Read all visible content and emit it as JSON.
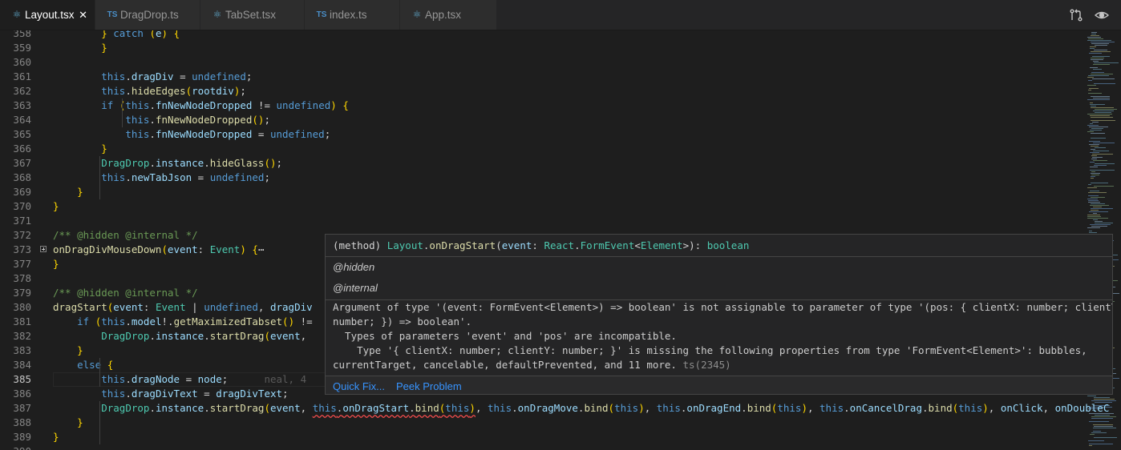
{
  "tabs": [
    {
      "name": "tab-layout",
      "label": "Layout.tsx",
      "icon": "react-icon",
      "active": true,
      "close": "✕"
    },
    {
      "name": "tab-dragdrop",
      "label": "DragDrop.ts",
      "icon": "ts-icon",
      "active": false
    },
    {
      "name": "tab-tabset",
      "label": "TabSet.tsx",
      "icon": "react-icon",
      "active": false
    },
    {
      "name": "tab-index",
      "label": "index.ts",
      "icon": "ts-icon",
      "active": false
    },
    {
      "name": "tab-app",
      "label": "App.tsx",
      "icon": "react-icon",
      "active": false
    }
  ],
  "icons": {
    "react": "⚛",
    "ts": "TS"
  },
  "toolbar": {
    "icons": [
      {
        "name": "open-changes-icon"
      },
      {
        "name": "toggle-inline-view-icon"
      }
    ]
  },
  "lines": [
    {
      "n": "358",
      "code": "        } catch (e) {"
    },
    {
      "n": "359",
      "code": "        }"
    },
    {
      "n": "360",
      "code": ""
    },
    {
      "n": "361",
      "code": "        this.dragDiv = undefined;"
    },
    {
      "n": "362",
      "code": "        this.hideEdges(rootdiv);"
    },
    {
      "n": "363",
      "code": "        if (this.fnNewNodeDropped != undefined) {"
    },
    {
      "n": "364",
      "code": "            this.fnNewNodeDropped();"
    },
    {
      "n": "365",
      "code": "            this.fnNewNodeDropped = undefined;"
    },
    {
      "n": "366",
      "code": "        }"
    },
    {
      "n": "367",
      "code": "        DragDrop.instance.hideGlass();"
    },
    {
      "n": "368",
      "code": "        this.newTabJson = undefined;"
    },
    {
      "n": "369",
      "code": "    }"
    },
    {
      "n": "370",
      "code": "}"
    },
    {
      "n": "371",
      "code": ""
    },
    {
      "n": "372",
      "code": "/** @hidden @internal */"
    },
    {
      "n": "373",
      "code": "onDragDivMouseDown(event: Event) {⋯",
      "fold": true
    },
    {
      "n": "377",
      "code": "}"
    },
    {
      "n": "378",
      "code": ""
    },
    {
      "n": "379",
      "code": "/** @hidden @internal */"
    },
    {
      "n": "380",
      "code": "dragStart(event: Event | undefined, dragDiv"
    },
    {
      "n": "381",
      "code": "    if (this.model!.getMaximizedTabset() != "
    },
    {
      "n": "382",
      "code": "        DragDrop.instance.startDrag(event, "
    },
    {
      "n": "383",
      "code": "    }"
    },
    {
      "n": "384",
      "code": "    else {"
    },
    {
      "n": "385",
      "code": "        this.dragNode = node;",
      "blame": "neal, 4",
      "current": true
    },
    {
      "n": "386",
      "code": "        this.dragDivText = dragDivText;"
    },
    {
      "n": "387",
      "code": "        DragDrop.instance.startDrag(event, this.onDragStart.bind(this), this.onDragMove.bind(this), this.onDragEnd.bind(this), this.onCancelDrag.bind(this), onClick, onDoubleC"
    },
    {
      "n": "388",
      "code": "    }"
    },
    {
      "n": "389",
      "code": "}"
    },
    {
      "n": "390",
      "code": ""
    }
  ],
  "hover": {
    "signature": "(method) Layout.onDragStart(event: React.FormEvent<Element>): boolean",
    "tag_hidden": "@hidden",
    "tag_internal": "@internal",
    "error_lines": [
      "Argument of type '(event: FormEvent<Element>) => boolean' is not assignable to parameter of type '(pos: { clientX: number; clientY:",
      "number; }) => boolean'.",
      "  Types of parameters 'event' and 'pos' are incompatible.",
      "    Type '{ clientX: number; clientY: number; }' is missing the following properties from type 'FormEvent<Element>': bubbles,",
      "currentTarget, cancelable, defaultPrevented, and 11 more."
    ],
    "error_code": "ts(2345)",
    "quick_fix": "Quick Fix...",
    "peek_problem": "Peek Problem"
  }
}
